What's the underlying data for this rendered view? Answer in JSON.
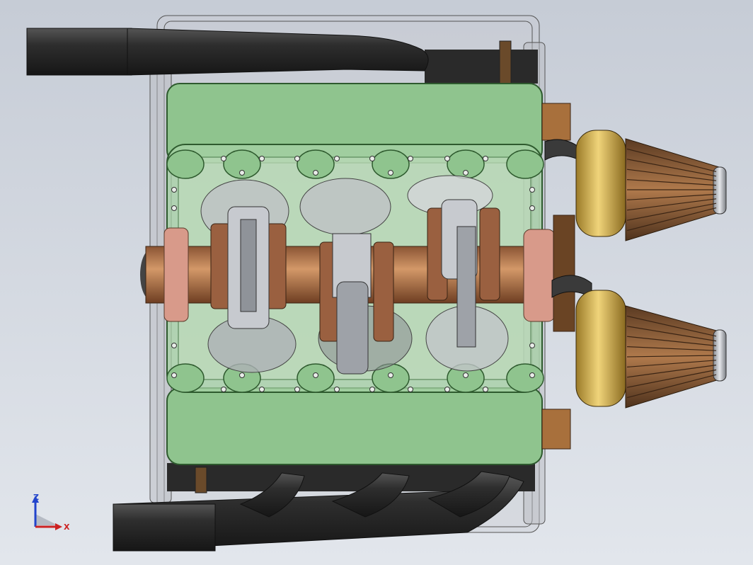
{
  "viewport": {
    "bg_top": "#c6ccd6",
    "bg_bottom": "#e2e6ec"
  },
  "model": {
    "block_color": "#8fc48e",
    "block_edge": "#2e5a2e",
    "crank_color": "#b8784a",
    "pipe_color": "#2b2b2b",
    "filter_cap_color": "#d8b85a",
    "filter_cone_color": "#8a5a34",
    "piston_color": "#b8bcc2"
  },
  "triad": {
    "z_label": "Z",
    "x_label": "X",
    "z_color": "#2244cc",
    "x_color": "#cc2222"
  }
}
